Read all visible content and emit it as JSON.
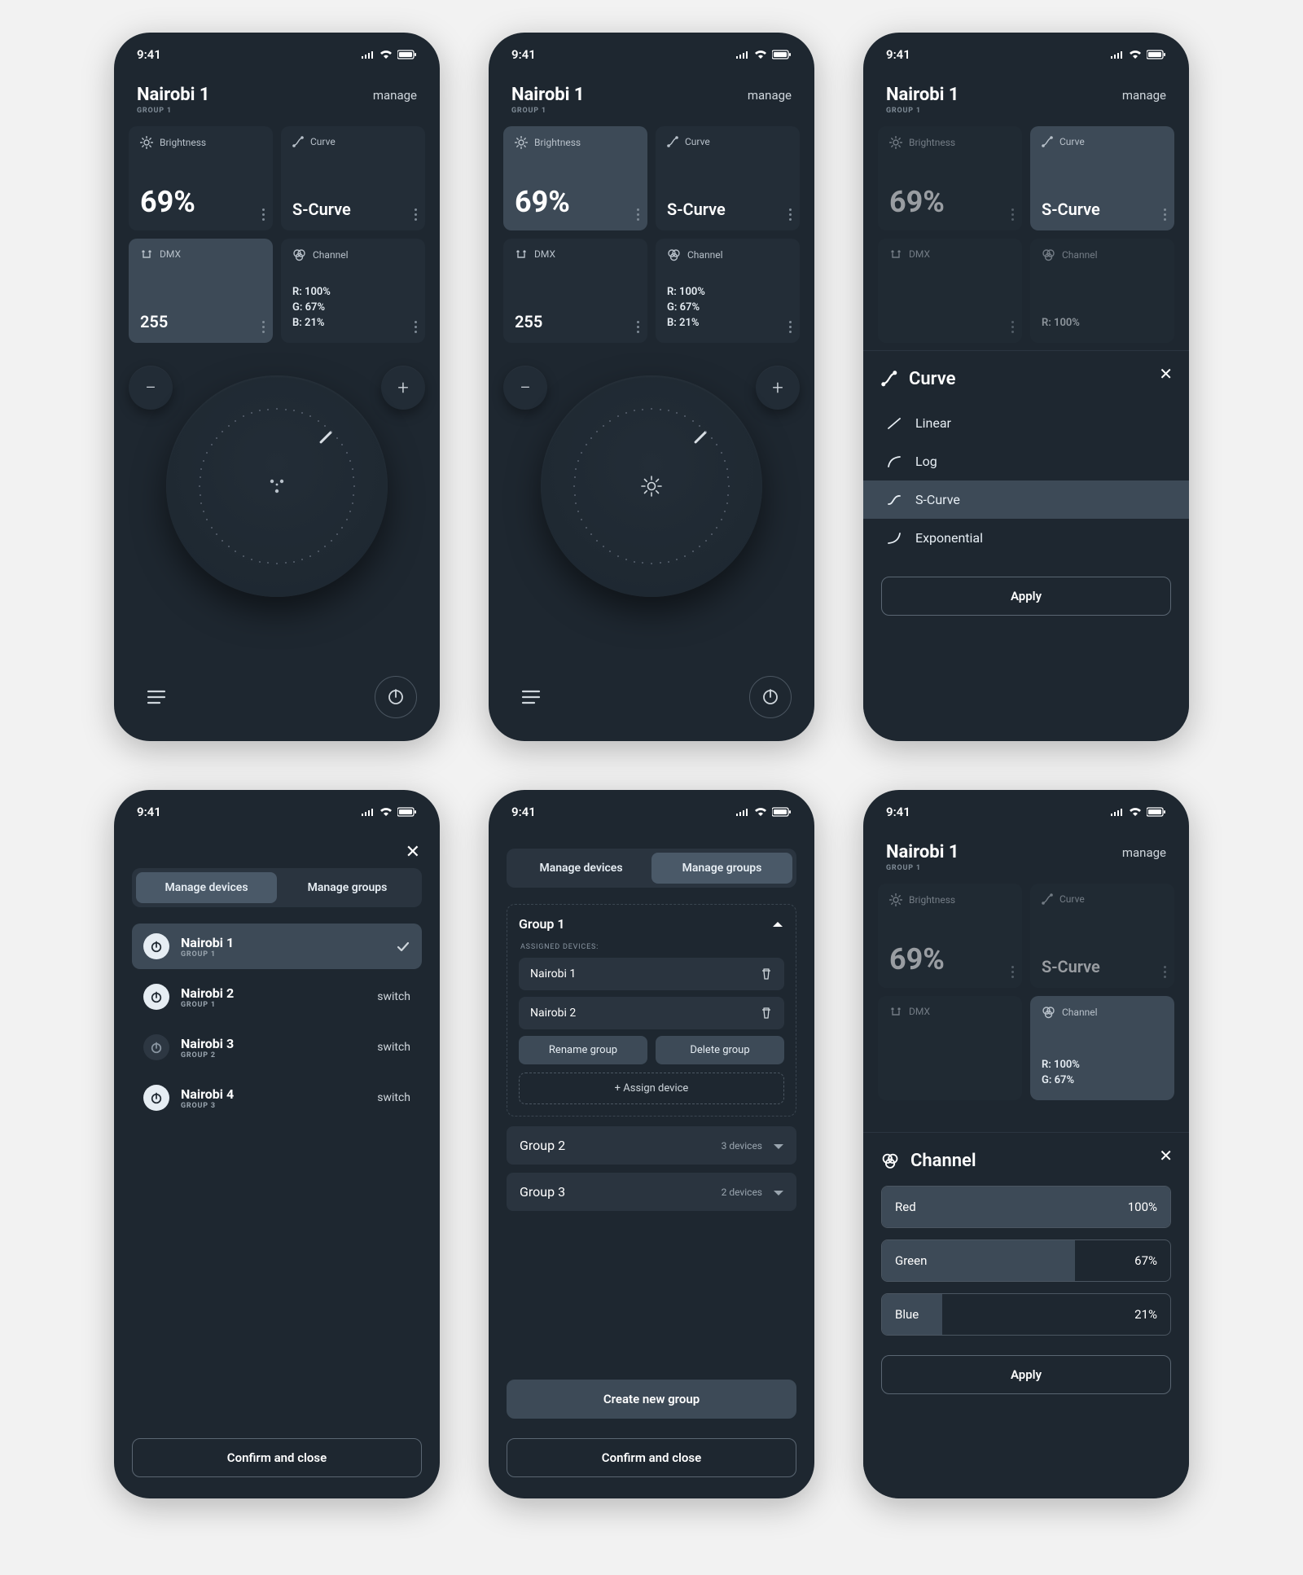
{
  "status": {
    "time": "9:41"
  },
  "header": {
    "title": "Nairobi 1",
    "subtitle": "GROUP 1",
    "manage": "manage"
  },
  "tiles": {
    "brightness": {
      "label": "Brightness",
      "value": "69%"
    },
    "curve": {
      "label": "Curve",
      "value": "S-Curve"
    },
    "dmx": {
      "label": "DMX",
      "value": "255"
    },
    "channel": {
      "label": "Channel",
      "r": "R: 100%",
      "g": "G: 67%",
      "b": "B: 21%"
    }
  },
  "s3": {
    "sheetTitle": "Curve",
    "options": {
      "linear": "Linear",
      "log": "Log",
      "scurve": "S-Curve",
      "exp": "Exponential"
    },
    "apply": "Apply"
  },
  "s4": {
    "tabDevices": "Manage devices",
    "tabGroups": "Manage groups",
    "confirm": "Confirm and close",
    "switch": "switch",
    "devices": [
      {
        "name": "Nairobi 1",
        "group": "GROUP 1",
        "selected": true,
        "on": true
      },
      {
        "name": "Nairobi 2",
        "group": "GROUP 1",
        "selected": false,
        "on": true
      },
      {
        "name": "Nairobi 3",
        "group": "GROUP 2",
        "selected": false,
        "on": false
      },
      {
        "name": "Nairobi 4",
        "group": "GROUP 3",
        "selected": false,
        "on": true
      }
    ]
  },
  "s5": {
    "tabDevices": "Manage devices",
    "tabGroups": "Manage groups",
    "group1": "Group 1",
    "assignedLabel": "ASSIGNED DEVICES:",
    "assigned1": "Nairobi 1",
    "assigned2": "Nairobi 2",
    "rename": "Rename group",
    "delete": "Delete group",
    "assign": "+ Assign device",
    "group2": "Group 2",
    "group2count": "3 devices",
    "group3": "Group 3",
    "group3count": "2 devices",
    "create": "Create new group",
    "confirm": "Confirm and close"
  },
  "s6": {
    "sheetTitle": "Channel",
    "red": "Red",
    "redVal": "100%",
    "redPct": 100,
    "green": "Green",
    "greenVal": "67%",
    "greenPct": 67,
    "blue": "Blue",
    "blueVal": "21%",
    "bluePct": 21,
    "apply": "Apply"
  }
}
